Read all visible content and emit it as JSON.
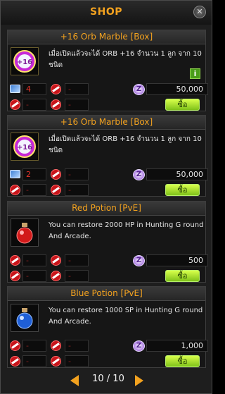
{
  "window": {
    "title": "SHOP",
    "close_icon": "close-icon"
  },
  "items": [
    {
      "name": "+16 Orb Marble [Box]",
      "description": "เมื่อเปิดแล้วจะได้ ORB +16 จำนวน 1 ลูก จาก 10 ชนิด",
      "icon": "orb-16-icon",
      "quantity": "4",
      "slot2": "-",
      "slot3": "-",
      "slot4": "-",
      "price": "50,000",
      "buy_label": "ซื้อ",
      "has_info": true,
      "info_label": "i"
    },
    {
      "name": "+16 Orb Marble [Box]",
      "description": "เมื่อเปิดแล้วจะได้ ORB +16 จำนวน 1 ลูก จาก 10 ชนิด",
      "icon": "orb-16-icon",
      "quantity": "2",
      "slot2": "-",
      "slot3": "-",
      "slot4": "-",
      "price": "50,000",
      "buy_label": "ซื้อ"
    },
    {
      "name": "Red Potion [PvE]",
      "description": "You can restore 2000 HP in Hunting G round And Arcade.",
      "icon": "red-potion-icon",
      "slot1": "-",
      "slot2": "-",
      "slot3": "-",
      "slot4": "-",
      "price": "500",
      "buy_label": "ซื้อ"
    },
    {
      "name": "Blue Potion [PvE]",
      "description": "You can restore 1000 SP in Hunting G round And Arcade.",
      "icon": "blue-potion-icon",
      "slot1": "-",
      "slot2": "-",
      "slot3": "-",
      "slot4": "-",
      "price": "1,000",
      "buy_label": "ซื้อ"
    }
  ],
  "pager": {
    "current": 10,
    "total": 10,
    "text": "10 / 10"
  },
  "colors": {
    "accent": "#f3a21f",
    "buy_button": "#a6e22e",
    "ban": "#c8141a"
  }
}
